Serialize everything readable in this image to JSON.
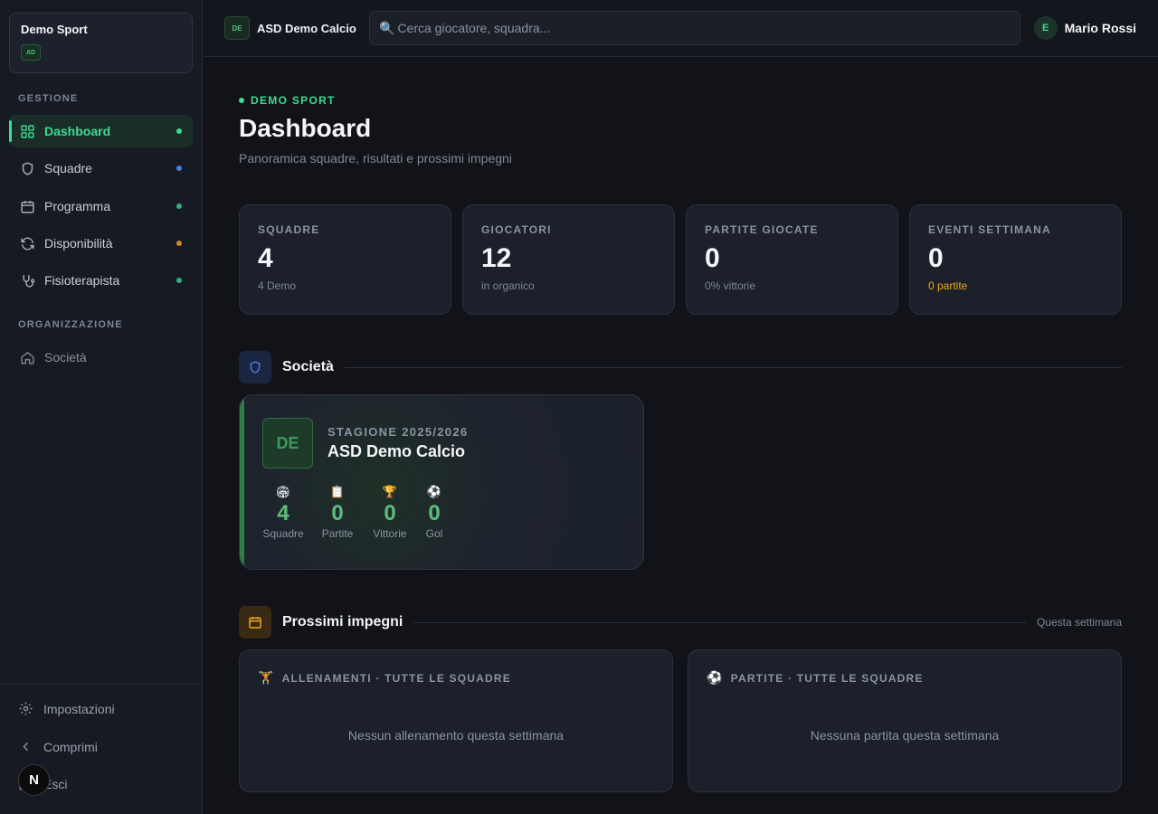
{
  "sidebar": {
    "org_name": "Demo Sport",
    "org_badge": "AD",
    "section_gestione": "GESTIONE",
    "section_organizzazione": "ORGANIZZAZIONE",
    "items": [
      {
        "label": "Dashboard",
        "icon": "grid-icon",
        "dot_color": "#3ddc8f"
      },
      {
        "label": "Squadre",
        "icon": "shield-icon",
        "dot_color": "#4a7fe0"
      },
      {
        "label": "Programma",
        "icon": "calendar-icon",
        "dot_color": "#2fb07a"
      },
      {
        "label": "Disponibilità",
        "icon": "refresh-icon",
        "dot_color": "#d08a2a"
      },
      {
        "label": "Fisioterapista",
        "icon": "stethoscope-icon",
        "dot_color": "#2fb07a"
      }
    ],
    "org_items": [
      {
        "label": "Società",
        "icon": "home-icon"
      }
    ],
    "bottom": {
      "settings": "Impostazioni",
      "collapse": "Comprimi",
      "logout": "Esci"
    },
    "floating_badge": "N"
  },
  "topbar": {
    "club_logo": "DE",
    "club_name": "ASD Demo Calcio",
    "search_placeholder": "Cerca giocatore, squadra...",
    "user_initial": "E",
    "user_name": "Mario Rossi"
  },
  "header": {
    "eyebrow": "DEMO SPORT",
    "title": "Dashboard",
    "subtitle": "Panoramica squadre, risultati e prossimi impegni"
  },
  "stats": [
    {
      "label": "SQUADRE",
      "value": "4",
      "sub": "4 Demo",
      "sub_color": "#7f8794"
    },
    {
      "label": "GIOCATORI",
      "value": "12",
      "sub": "in organico",
      "sub_color": "#7f8794"
    },
    {
      "label": "PARTITE GIOCATE",
      "value": "0",
      "sub": "0% vittorie",
      "sub_color": "#7f8794"
    },
    {
      "label": "EVENTI SETTIMANA",
      "value": "0",
      "sub": "0 partite",
      "sub_color": "#f0a81c"
    }
  ],
  "societa": {
    "section_title": "Società",
    "logo": "DE",
    "season": "STAGIONE 2025/2026",
    "name": "ASD Demo Calcio",
    "metrics": [
      {
        "emoji": "🏟",
        "value": "4",
        "label": "Squadre"
      },
      {
        "emoji": "📋",
        "value": "0",
        "label": "Partite"
      },
      {
        "emoji": "🏆",
        "value": "0",
        "label": "Vittorie"
      },
      {
        "emoji": "⚽",
        "value": "0",
        "label": "Gol"
      }
    ]
  },
  "impegni": {
    "section_title": "Prossimi impegni",
    "meta": "Questa settimana",
    "cards": [
      {
        "emoji": "🏋",
        "title": "ALLENAMENTI · TUTTE LE SQUADRE",
        "empty": "Nessun allenamento questa settimana"
      },
      {
        "emoji": "⚽",
        "title": "PARTITE · TUTTE LE SQUADRE",
        "empty": "Nessuna partita questa settimana"
      }
    ]
  },
  "colors": {
    "accent": "#3ddc8f",
    "background": "#111318",
    "card": "#1b202a",
    "warning": "#f0a81c"
  }
}
